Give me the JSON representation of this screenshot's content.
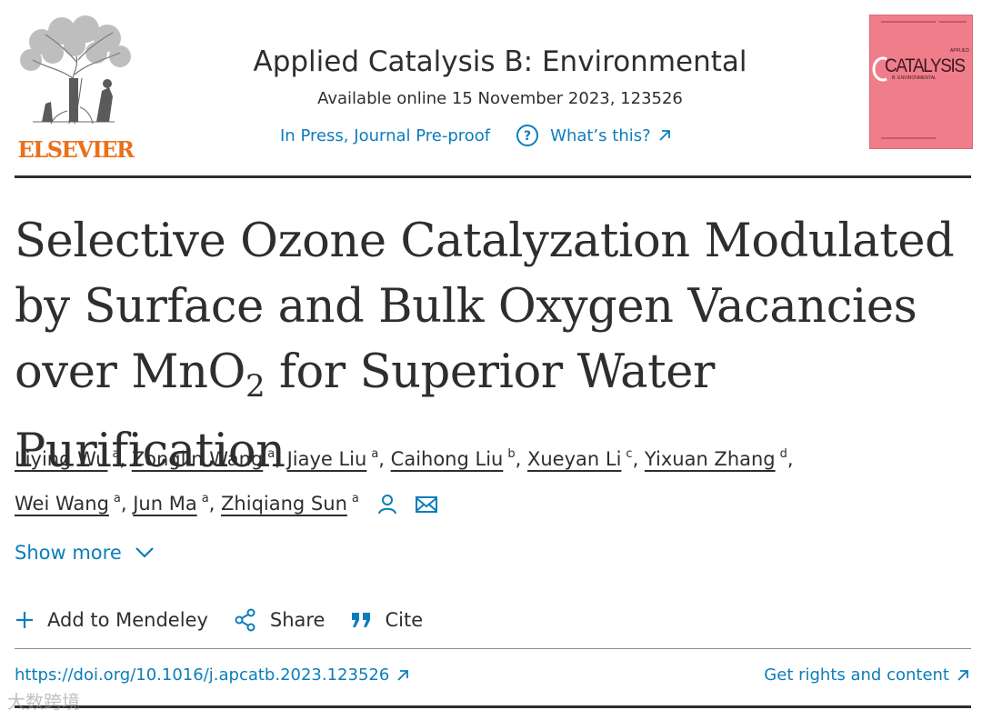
{
  "publisher": {
    "name": "ELSEVIER",
    "brand_color": "#e9711c"
  },
  "journal": {
    "title": "Applied Catalysis B: Environmental",
    "availability": "Available online 15 November 2023, 123526",
    "status_link": "In Press, Journal Pre-proof",
    "help_link": "What’s this?",
    "link_color": "#0c7dbb"
  },
  "cover": {
    "applied": "APPLIED",
    "catalysis": "CATALYSIS",
    "sub": "B: ENVIRONMENTAL",
    "color": "#f07d8a"
  },
  "article": {
    "title_line1": "Selective Ozone Catalyzation Modulated",
    "title_line2": "by Surface and Bulk Oxygen Vacancies",
    "title_line3_pre": "over MnO",
    "title_line3_sub": "2",
    "title_line3_post": " for Superior Water Purification"
  },
  "authors": [
    {
      "name": "Liying Wu",
      "aff": "a"
    },
    {
      "name": "Zonglin Wang",
      "aff": "a"
    },
    {
      "name": "Jiaye Liu",
      "aff": "a"
    },
    {
      "name": "Caihong Liu",
      "aff": "b"
    },
    {
      "name": "Xueyan Li",
      "aff": "c"
    },
    {
      "name": "Yixuan Zhang",
      "aff": "d"
    },
    {
      "name": "Wei Wang",
      "aff": "a"
    },
    {
      "name": "Jun Ma",
      "aff": "a"
    },
    {
      "name": "Zhiqiang Sun",
      "aff": "a"
    }
  ],
  "show_more": "Show more",
  "toolbar": {
    "mendeley": "Add to Mendeley",
    "share": "Share",
    "cite": "Cite"
  },
  "doi": "https://doi.org/10.1016/j.apcatb.2023.123526",
  "rights": "Get rights and content",
  "watermark": "大数跨境"
}
